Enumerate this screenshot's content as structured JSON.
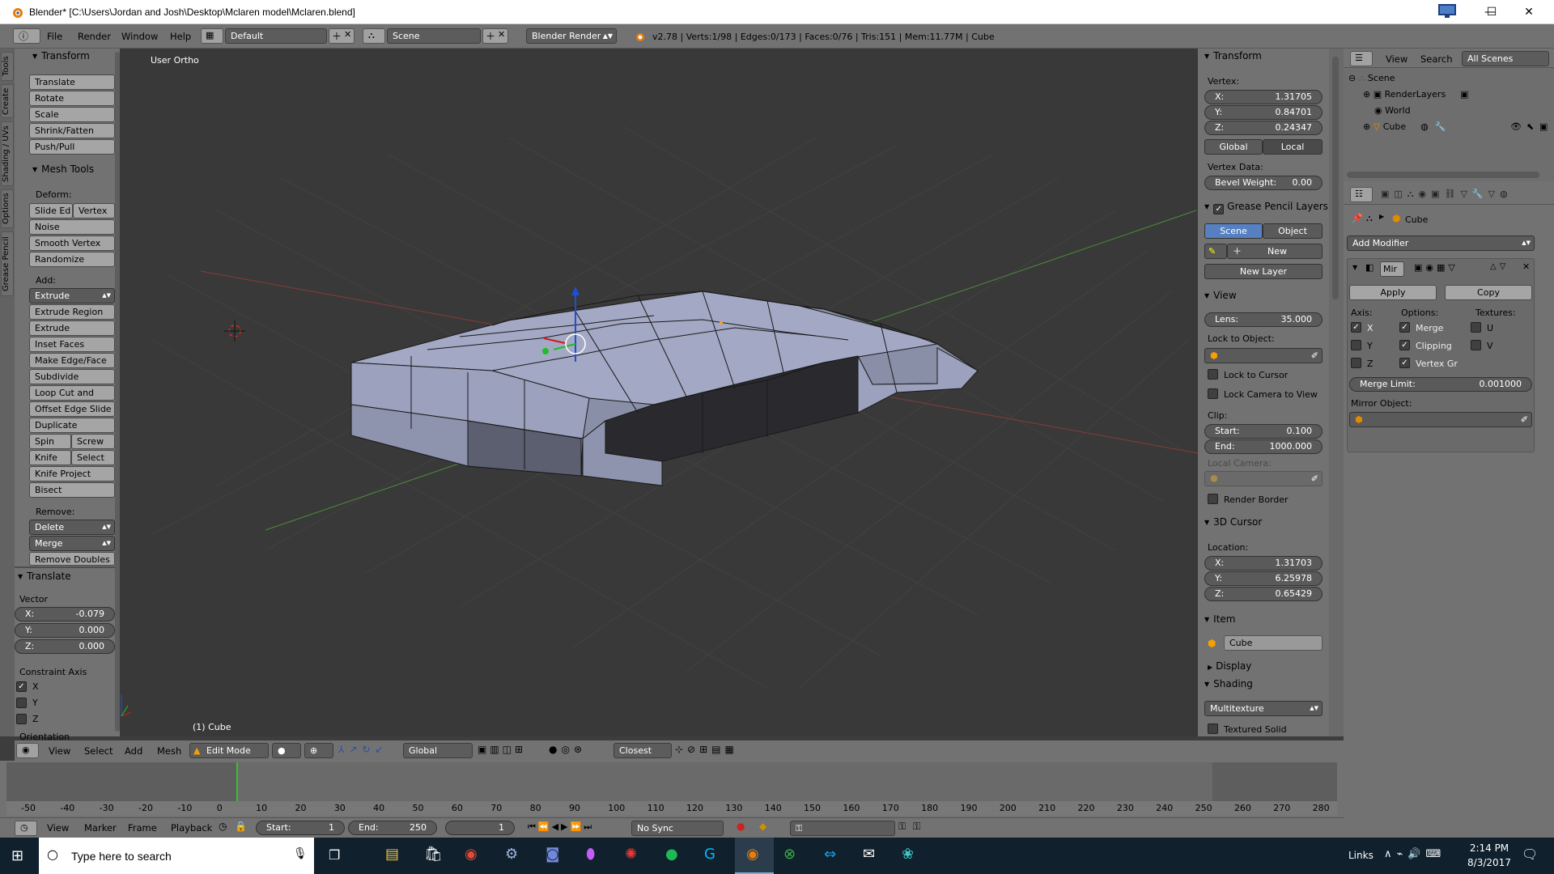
{
  "window": {
    "title": "Blender* [C:\\Users\\Jordan and Josh\\Desktop\\Mclaren model\\Mclaren.blend]",
    "minimize_glyph": "—",
    "maximize_glyph": "☐",
    "close_glyph": "✕"
  },
  "menubar": {
    "info_icon": "info-icon",
    "menus": [
      "File",
      "Render",
      "Window",
      "Help"
    ],
    "layout": "Default",
    "scene": "Scene",
    "engine": "Blender Render",
    "stats": "v2.78 | Verts:1/98 | Edges:0/173 | Faces:0/76 | Tris:151 | Mem:11.77M | Cube"
  },
  "left_tabs": [
    "Tools",
    "Create",
    "Shading / UVs",
    "Options",
    "Grease Pencil"
  ],
  "tool_shelf": {
    "transform_header": "Transform",
    "transform_buttons": [
      "Translate",
      "Rotate",
      "Scale",
      "Shrink/Fatten",
      "Push/Pull"
    ],
    "mesh_tools_header": "Mesh Tools",
    "deform_label": "Deform:",
    "slide_edge": "Slide Ed",
    "vertex": "Vertex",
    "deform_buttons": [
      "Noise",
      "Smooth Vertex",
      "Randomize"
    ],
    "add_label": "Add:",
    "extrude": "Extrude",
    "add_buttons": [
      "Extrude Region",
      "Extrude Individual",
      "Inset Faces",
      "Make Edge/Face",
      "Subdivide",
      "Loop Cut and Slide",
      "Offset Edge Slide",
      "Duplicate"
    ],
    "spin": "Spin",
    "screw": "Screw",
    "knife": "Knife",
    "select": "Select",
    "knife_project": "Knife Project",
    "bisect": "Bisect",
    "remove_label": "Remove:",
    "delete": "Delete",
    "merge": "Merge",
    "remove_doubles": "Remove Doubles"
  },
  "operator_panel": {
    "header": "Translate",
    "vector_label": "Vector",
    "x_label": "X:",
    "x_value": "-0.079",
    "y_label": "Y:",
    "y_value": "0.000",
    "z_label": "Z:",
    "z_value": "0.000",
    "constraint_label": "Constraint Axis",
    "axes": [
      "X",
      "Y",
      "Z"
    ],
    "orientation_label": "Orientation"
  },
  "viewport": {
    "view_name": "User Ortho",
    "object_label": "(1) Cube"
  },
  "n_panel": {
    "transform_header": "Transform",
    "vertex_label": "Vertex:",
    "vx_label": "X:",
    "vx": "1.31705",
    "vy_label": "Y:",
    "vy": "0.84701",
    "vz_label": "Z:",
    "vz": "0.24347",
    "global": "Global",
    "local": "Local",
    "vertex_data_label": "Vertex Data:",
    "bevel_label": "Bevel Weight:",
    "bevel_value": "0.00",
    "gp_header": "Grease Pencil Layers",
    "gp_scene": "Scene",
    "gp_object": "Object",
    "gp_new": "New",
    "gp_new_layer": "New Layer",
    "view_header": "View",
    "lens_label": "Lens:",
    "lens_value": "35.000",
    "lock_object_label": "Lock to Object:",
    "lock_cursor": "Lock to Cursor",
    "lock_camera": "Lock Camera to View",
    "clip_label": "Clip:",
    "clip_start_label": "Start:",
    "clip_start": "0.100",
    "clip_end_label": "End:",
    "clip_end": "1000.000",
    "local_camera_label": "Local Camera:",
    "render_border": "Render Border",
    "cursor_header": "3D Cursor",
    "location_label": "Location:",
    "cx_label": "X:",
    "cx": "1.31703",
    "cy_label": "Y:",
    "cy": "6.25978",
    "cz_label": "Z:",
    "cz": "0.65429",
    "item_header": "Item",
    "item_name": "Cube",
    "display_header": "Display",
    "shading_header": "Shading",
    "shading_mode": "Multitexture",
    "textured_solid": "Textured Solid"
  },
  "outliner": {
    "view": "View",
    "search": "Search",
    "filter": "All Scenes",
    "items": [
      {
        "label": "Scene",
        "depth": 0
      },
      {
        "label": "RenderLayers",
        "depth": 1
      },
      {
        "label": "World",
        "depth": 1
      },
      {
        "label": "Cube",
        "depth": 1
      }
    ]
  },
  "properties": {
    "context_object": "Cube",
    "add_modifier": "Add Modifier",
    "modifier_name": "Mir",
    "apply": "Apply",
    "copy": "Copy",
    "axis_label": "Axis:",
    "options_label": "Options:",
    "textures_label": "Textures:",
    "axes": [
      "X",
      "Y",
      "Z"
    ],
    "axes_checked": [
      true,
      false,
      false
    ],
    "options": [
      "Merge",
      "Clipping",
      "Vertex Gr"
    ],
    "textures": [
      "U",
      "V"
    ],
    "merge_limit_label": "Merge Limit:",
    "merge_limit": "0.001000",
    "mirror_object_label": "Mirror Object:"
  },
  "viewport_header": {
    "menus": [
      "View",
      "Select",
      "Add",
      "Mesh"
    ],
    "mode": "Edit Mode",
    "orientation": "Global",
    "snap": "Closest"
  },
  "timeline": {
    "ruler": [
      "-50",
      "-40",
      "-30",
      "-20",
      "-10",
      "0",
      "10",
      "20",
      "30",
      "40",
      "50",
      "60",
      "70",
      "80",
      "90",
      "100",
      "110",
      "120",
      "130",
      "140",
      "150",
      "160",
      "170",
      "180",
      "190",
      "200",
      "210",
      "220",
      "230",
      "240",
      "250",
      "260",
      "270",
      "280"
    ],
    "current_frame_value": 0,
    "menus": [
      "View",
      "Marker",
      "Frame",
      "Playback"
    ],
    "start_label": "Start:",
    "start": "1",
    "end_label": "End:",
    "end": "250",
    "current": "1",
    "sync": "No Sync"
  },
  "taskbar": {
    "search_placeholder": "Type here to search",
    "links": "Links",
    "time": "2:14 PM",
    "date": "8/3/2017"
  }
}
